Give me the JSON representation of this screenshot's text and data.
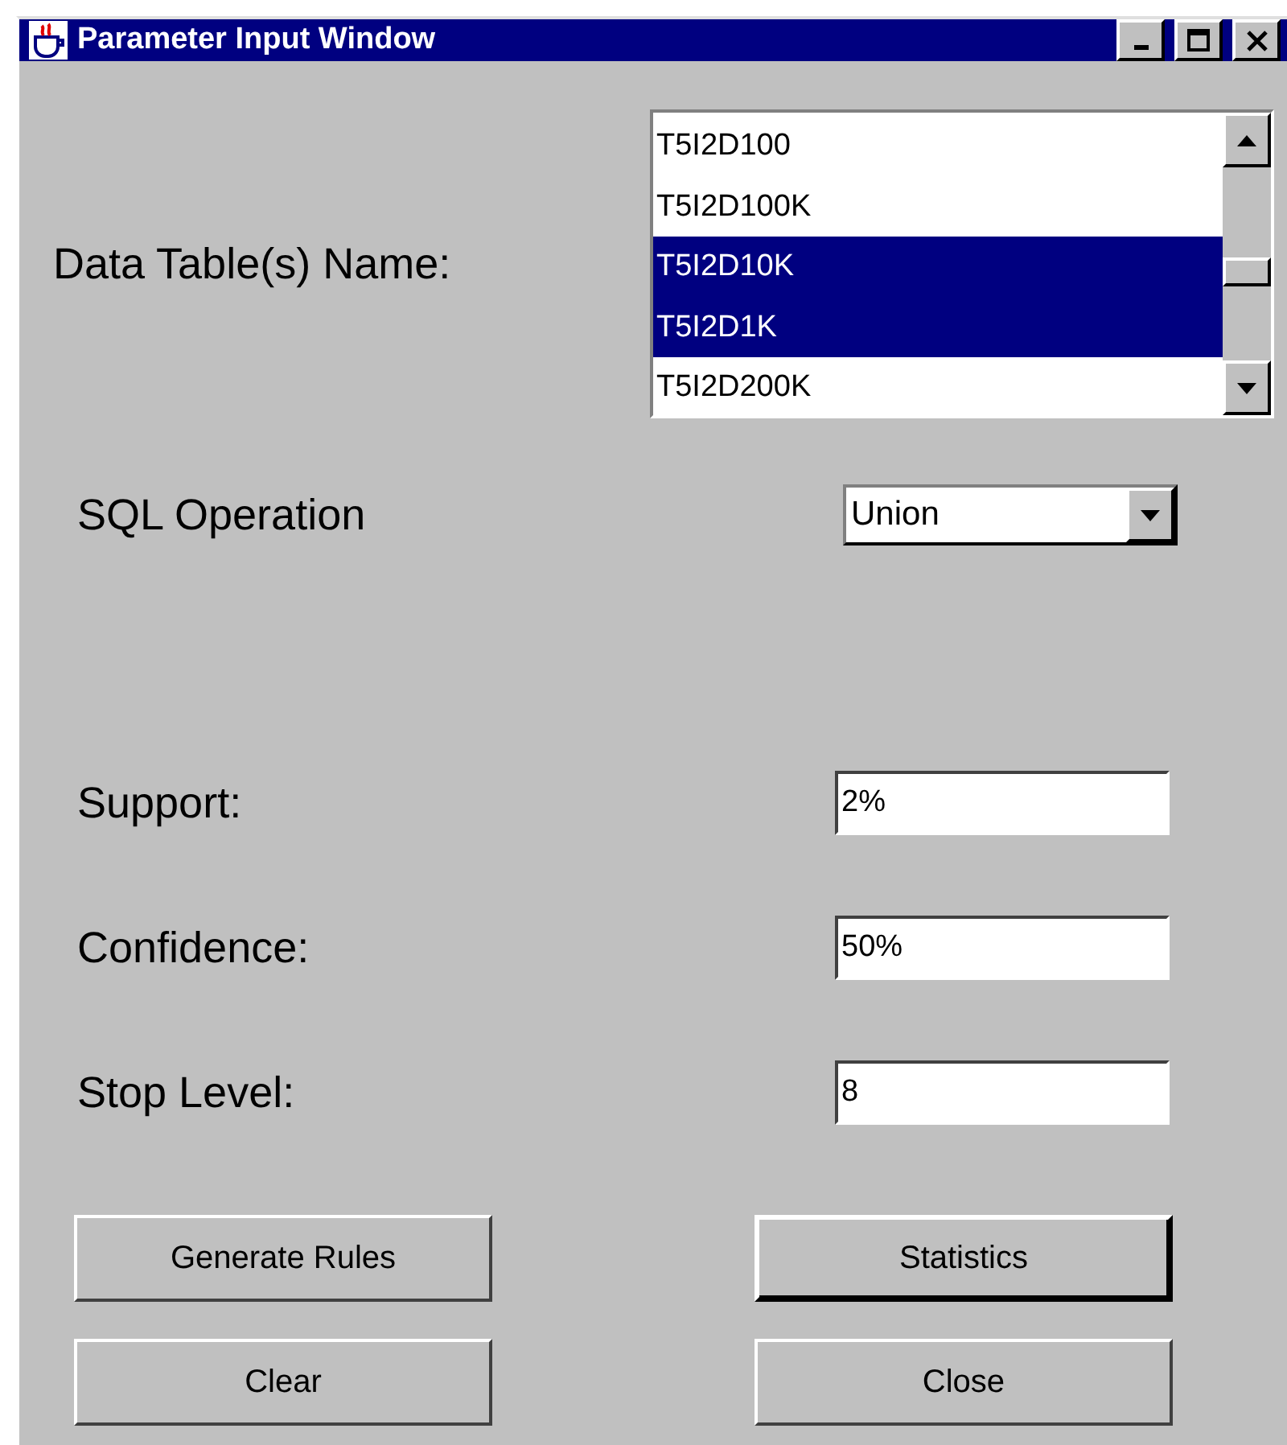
{
  "window": {
    "title": "Parameter Input Window"
  },
  "tables": {
    "label": "Data Table(s) Name:",
    "items": [
      {
        "name": "T5I2D100",
        "selected": false
      },
      {
        "name": "T5I2D100K",
        "selected": false
      },
      {
        "name": "T5I2D10K",
        "selected": true
      },
      {
        "name": "T5I2D1K",
        "selected": true
      },
      {
        "name": "T5I2D200K",
        "selected": false
      }
    ]
  },
  "sql": {
    "label": "SQL Operation",
    "value": "Union"
  },
  "fields": [
    {
      "label": "Support:",
      "value": "2%"
    },
    {
      "label": "Confidence:",
      "value": "50%"
    },
    {
      "label": "Stop Level:",
      "value": "8"
    }
  ],
  "buttons": [
    {
      "label": "Generate Rules",
      "focused": false
    },
    {
      "label": "Statistics",
      "focused": true
    },
    {
      "label": "Clear",
      "focused": false
    },
    {
      "label": "Close",
      "focused": false
    }
  ]
}
